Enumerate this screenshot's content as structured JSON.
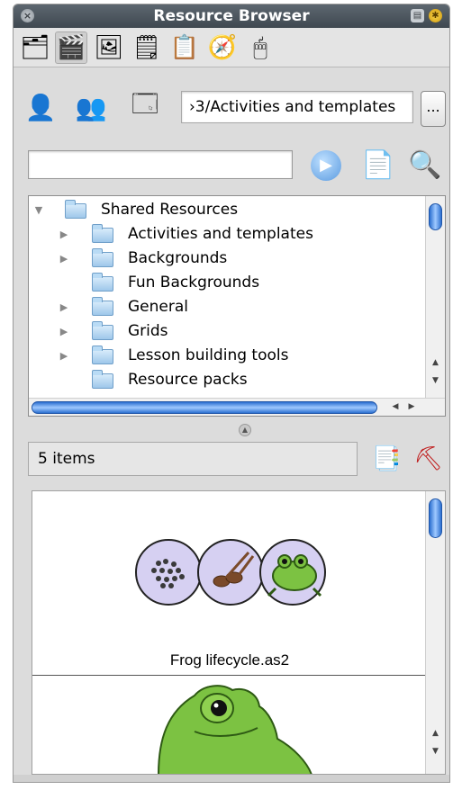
{
  "window": {
    "title": "Resource Browser",
    "close_glyph": "×",
    "minimize_glyph": "▤",
    "options_glyph": "✱"
  },
  "tabs": [
    {
      "icon": "pages-icon",
      "glyph": "🗂"
    },
    {
      "icon": "gallery-icon",
      "glyph": "🎬"
    },
    {
      "icon": "shared-resources-icon",
      "glyph": "🖼"
    },
    {
      "icon": "notes-icon",
      "glyph": "🗒"
    },
    {
      "icon": "lesson-plan-icon",
      "glyph": "📋"
    },
    {
      "icon": "spinner-icon",
      "glyph": "🧭"
    },
    {
      "icon": "mouse-icon",
      "glyph": "🖱"
    }
  ],
  "location": {
    "path": "›3/Activities and templates",
    "more_label": "...",
    "user_glyph": "👤",
    "group_glyph": "👥",
    "shared_glyph": "🗔"
  },
  "search": {
    "value": "",
    "placeholder": "",
    "go_glyph": "▶",
    "doc_glyph": "📄",
    "find_glyph": "🔍"
  },
  "tree": {
    "root": "Shared Resources",
    "items": [
      {
        "label": "Activities and templates",
        "expandable": true
      },
      {
        "label": "Backgrounds",
        "expandable": true
      },
      {
        "label": "Fun Backgrounds",
        "expandable": false
      },
      {
        "label": "General",
        "expandable": true
      },
      {
        "label": "Grids",
        "expandable": true
      },
      {
        "label": "Lesson building tools",
        "expandable": true
      },
      {
        "label": "Resource packs",
        "expandable": false
      }
    ],
    "expanded_glyph": "▼",
    "collapsed_glyph": "▶"
  },
  "results": {
    "count_label": "5 items",
    "props_glyph": "📑",
    "stamp_glyph": "⛏",
    "items": [
      {
        "label": "Frog lifecycle.as2"
      }
    ]
  },
  "colors": {
    "accent": "#2b6fd0",
    "frog_green": "#7cc242",
    "circle_fill": "#d6d0f2"
  }
}
